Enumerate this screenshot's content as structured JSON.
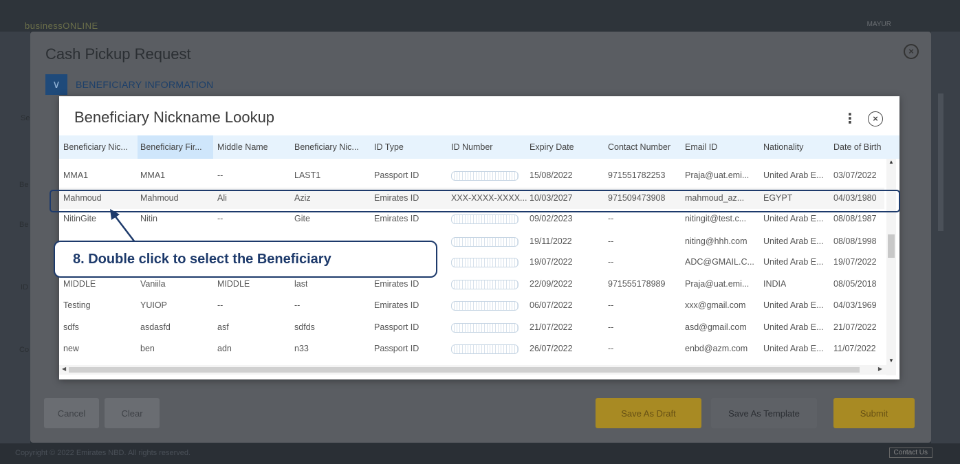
{
  "app": {
    "brand": "businessONLINE",
    "user": "MAYUR",
    "footer_text": "Copyright © 2022 Emirates NBD. All rights reserved.",
    "footer_btn": "Contact Us"
  },
  "background_dialog": {
    "title": "Cash Pickup Request",
    "section_label": "BENEFICIARY INFORMATION",
    "fragments": [
      "Se",
      "Be",
      "Be",
      "ID",
      "Co"
    ],
    "buttons": {
      "cancel": "Cancel",
      "clear": "Clear",
      "save_draft": "Save As Draft",
      "save_template": "Save As Template",
      "submit": "Submit"
    }
  },
  "lookup": {
    "title": "Beneficiary Nickname Lookup",
    "columns": [
      "Beneficiary Nic...",
      "Beneficiary Fir...",
      "Middle Name",
      "Beneficiary Nic...",
      "ID Type",
      "ID Number",
      "Expiry Date",
      "Contact Number",
      "Email ID",
      "Nationality",
      "Date of Birth"
    ],
    "rows": [
      [
        "MMA1",
        "MMA1",
        "--",
        "LAST1",
        "Passport ID",
        "",
        "15/08/2022",
        "971551782253",
        "Praja@uat.emi...",
        "United Arab E...",
        "03/07/2022"
      ],
      [
        "Mahmoud",
        "Mahmoud",
        "Ali",
        "Aziz",
        "Emirates ID",
        "XXX-XXXX-XXXX...",
        "10/03/2027",
        "971509473908",
        "mahmoud_az...",
        "EGYPT",
        "04/03/1980"
      ],
      [
        "NitinGite",
        "Nitin",
        "--",
        "Gite",
        "Emirates ID",
        "",
        "09/02/2023",
        "--",
        "nitingit@test.c...",
        "United Arab E...",
        "08/08/1987"
      ],
      [
        "",
        "",
        "",
        "",
        "",
        "",
        "19/11/2022",
        "--",
        "niting@hhh.com",
        "United Arab E...",
        "08/08/1998"
      ],
      [
        "",
        "",
        "",
        "",
        "",
        "",
        "19/07/2022",
        "--",
        "ADC@GMAIL.C...",
        "United Arab E...",
        "19/07/2022"
      ],
      [
        "MIDDLE",
        "Vaniila",
        "MIDDLE",
        "last",
        "Emirates ID",
        "",
        "22/09/2022",
        "971555178989",
        "Praja@uat.emi...",
        "INDIA",
        "08/05/2018"
      ],
      [
        "Testing",
        "YUIOP",
        "--",
        "--",
        "Emirates ID",
        "",
        "06/07/2022",
        "--",
        "xxx@gmail.com",
        "United Arab E...",
        "04/03/1969"
      ],
      [
        "sdfs",
        "asdasfd",
        "asf",
        "sdfds",
        "Passport ID",
        "",
        "21/07/2022",
        "--",
        "asd@gmail.com",
        "United Arab E...",
        "21/07/2022"
      ],
      [
        "new",
        "ben",
        "adn",
        "n33",
        "Passport ID",
        "",
        "26/07/2022",
        "--",
        "enbd@azm.com",
        "United Arab E...",
        "11/07/2022"
      ]
    ],
    "masked_rows": [
      0,
      2,
      3,
      4,
      5,
      6,
      7,
      8
    ],
    "highlighted_row": 1
  },
  "callout": {
    "text": "8.  Double click to select the Beneficiary"
  },
  "colors": {
    "accent": "#1d3a6b",
    "header_bg": "#e7f3fd",
    "submit": "#f0b429"
  }
}
